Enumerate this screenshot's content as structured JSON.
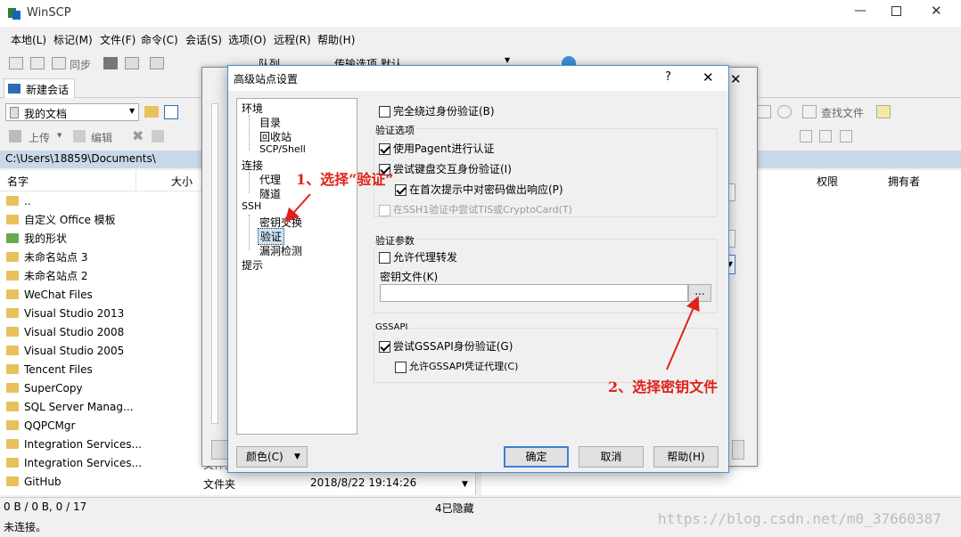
{
  "window": {
    "title": "WinSCP"
  },
  "menu": [
    "本地(L)",
    "标记(M)",
    "文件(F)",
    "命令(C)",
    "会话(S)",
    "选项(O)",
    "远程(R)",
    "帮助(H)"
  ],
  "toolbar": {
    "sync": "同步",
    "queue": "队列",
    "transfer": "传输选项 默认"
  },
  "session_tab": "新建会话",
  "local": {
    "location": "我的文档",
    "upload": "上传",
    "edit": "编辑",
    "path": "C:\\Users\\18859\\Documents\\",
    "columns": {
      "name": "名字",
      "size": "大小"
    },
    "files": [
      {
        "name": ".."
      },
      {
        "name": "自定义 Office 模板"
      },
      {
        "name": "我的形状"
      },
      {
        "name": "未命名站点 3"
      },
      {
        "name": "未命名站点 2"
      },
      {
        "name": "WeChat Files"
      },
      {
        "name": "Visual Studio 2013"
      },
      {
        "name": "Visual Studio 2008"
      },
      {
        "name": "Visual Studio 2005"
      },
      {
        "name": "Tencent Files"
      },
      {
        "name": "SuperCopy"
      },
      {
        "name": "SQL Server Manag..."
      },
      {
        "name": "QQPCMgr"
      },
      {
        "name": "Integration Services..."
      },
      {
        "name": "Integration Services..."
      },
      {
        "name": "GitHub"
      }
    ],
    "partial_type": "文件夹",
    "last_row": {
      "type": "文件夹",
      "modified": "2018/8/22  19:14:26"
    },
    "status": "0 B / 0 B,  0 / 17",
    "hidden": "4已隐藏"
  },
  "remote": {
    "find_files": "查找文件",
    "columns": {
      "perm": "权限",
      "owner": "拥有者"
    }
  },
  "status_bar": "未连接。",
  "dialog": {
    "title": "高级站点设置",
    "help_glyph": "?",
    "close_glyph": "✕",
    "tree": {
      "env": "环境",
      "dir": "目录",
      "recycle": "回收站",
      "scp": "SCP/Shell",
      "conn": "连接",
      "proxy": "代理",
      "tunnel": "隧道",
      "ssh": "SSH",
      "kex": "密钥交换",
      "auth": "验证",
      "bugs": "漏洞检测",
      "note": "提示"
    },
    "bypass_auth": "完全绕过身份验证(B)",
    "auth_options": {
      "title": "验证选项",
      "pagent": "使用Pagent进行认证",
      "kbd_interactive": "尝试键盘交互身份验证(I)",
      "first_prompt": "在首次提示中对密码做出响应(P)",
      "tis": "在SSH1验证中尝试TIS或CryptoCard(T)"
    },
    "auth_params": {
      "title": "验证参数",
      "agent_fwd": "允许代理转发",
      "key_file_label": "密钥文件(K)",
      "key_file_value": "",
      "browse": "..."
    },
    "gssapi": {
      "title": "GSSAPI",
      "try": "尝试GSSAPI身份验证(G)",
      "delegation": "允许GSSAPI凭证代理(C)"
    },
    "color_btn": "颜色(C)",
    "ok": "确定",
    "cancel": "取消",
    "help": "帮助(H)"
  },
  "annotations": {
    "step1": "1、选择“验证”",
    "step2": "2、选择密钥文件",
    "color": "#e0201a"
  },
  "watermark": "https://blog.csdn.net/m0_37660387"
}
